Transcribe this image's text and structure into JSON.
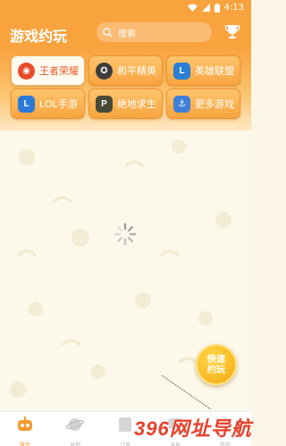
{
  "status_bar": {
    "time": "4:13"
  },
  "header": {
    "title": "游戏约玩",
    "search_placeholder": "搜索"
  },
  "games": [
    {
      "label": "王者荣耀",
      "active": true,
      "color": "#e94c2b"
    },
    {
      "label": "和平精英",
      "active": false,
      "color": "#3c3c3c"
    },
    {
      "label": "英雄联盟",
      "active": false,
      "color": "#2a7fd4"
    },
    {
      "label": "LOL手游",
      "active": false,
      "color": "#2c79d6"
    },
    {
      "label": "绝地求生",
      "active": false,
      "color": "#4a4a3a"
    },
    {
      "label": "更多游戏",
      "active": false,
      "color": "#3f7fd9"
    }
  ],
  "fab": {
    "line1": "快速",
    "line2": "约玩"
  },
  "tabs": [
    {
      "label": "首页",
      "active": true
    },
    {
      "label": "发现",
      "active": false
    },
    {
      "label": "订单",
      "active": false
    },
    {
      "label": "消息",
      "active": false
    },
    {
      "label": "我的",
      "active": false
    }
  ],
  "watermark": "396网址导航",
  "colors": {
    "accent": "#f9a33f",
    "selected_text": "#e85c2a"
  }
}
